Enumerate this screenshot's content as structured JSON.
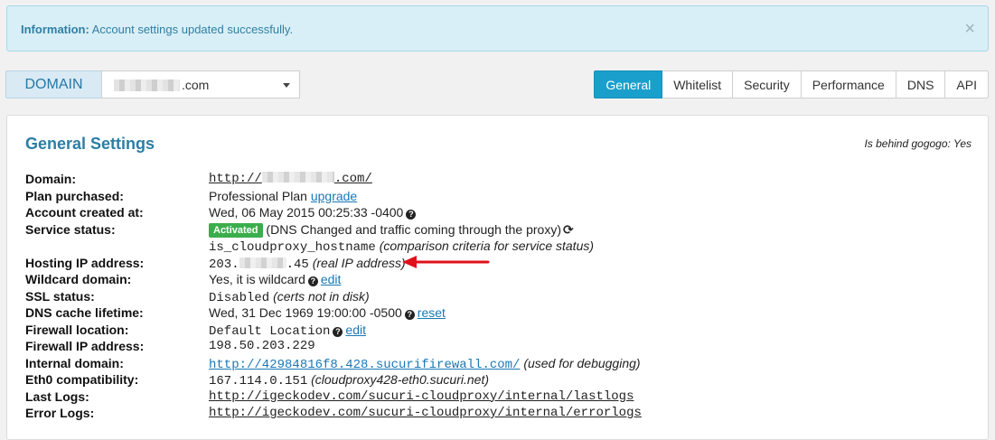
{
  "alert": {
    "label": "Information:",
    "message": "Account settings updated successfully.",
    "close": "×"
  },
  "domain": {
    "label": "DOMAIN",
    "selected_suffix": ".com"
  },
  "tabs": [
    "General",
    "Whitelist",
    "Security",
    "Performance",
    "DNS",
    "API"
  ],
  "active_tab": "General",
  "panel": {
    "title": "General Settings",
    "behind": "Is behind gogogo: Yes"
  },
  "rows": {
    "domain": {
      "label": "Domain:",
      "prefix": "http://",
      "suffix": ".com/"
    },
    "plan": {
      "label": "Plan purchased:",
      "value": "Professional Plan",
      "link": "upgrade"
    },
    "created": {
      "label": "Account created at:",
      "value": "Wed, 06 May 2015 00:25:33 -0400"
    },
    "status": {
      "label": "Service status:",
      "badge": "Activated",
      "text": "(DNS Changed and traffic coming through the proxy)",
      "refresh": "⟳"
    },
    "status2": {
      "mono": "is_cloudproxy_hostname",
      "note": "(comparison criteria for service status)"
    },
    "hosting_ip": {
      "label": "Hosting IP address:",
      "prefix": "203.",
      "suffix": ".45",
      "note": "(real IP address)"
    },
    "wildcard": {
      "label": "Wildcard domain:",
      "value": "Yes, it is wildcard",
      "link": "edit"
    },
    "ssl": {
      "label": "SSL status:",
      "value": "Disabled",
      "note": "(certs not in disk)"
    },
    "dns_cache": {
      "label": "DNS cache lifetime:",
      "value": "Wed, 31 Dec 1969 19:00:00 -0500",
      "link": "reset"
    },
    "fw_location": {
      "label": "Firewall location:",
      "value": "Default Location",
      "link": "edit"
    },
    "fw_ip": {
      "label": "Firewall IP address:",
      "value": "198.50.203.229"
    },
    "internal": {
      "label": "Internal domain:",
      "link": "http://42984816f8.428.sucurifirewall.com/",
      "note": "(used for debugging)"
    },
    "eth0": {
      "label": "Eth0 compatibility:",
      "value": "167.114.0.151",
      "note": "(cloudproxy428-eth0.sucuri.net)"
    },
    "last_logs": {
      "label": "Last Logs:",
      "link": "http://igeckodev.com/sucuri-cloudproxy/internal/lastlogs"
    },
    "error_logs": {
      "label": "Error Logs:",
      "link": "http://igeckodev.com/sucuri-cloudproxy/internal/errorlogs"
    }
  },
  "help_icon": "?",
  "colors": {
    "accent": "#1a9fcc",
    "title": "#2b7ea5",
    "badge": "#3bae4c",
    "arrow": "#e0101a"
  }
}
